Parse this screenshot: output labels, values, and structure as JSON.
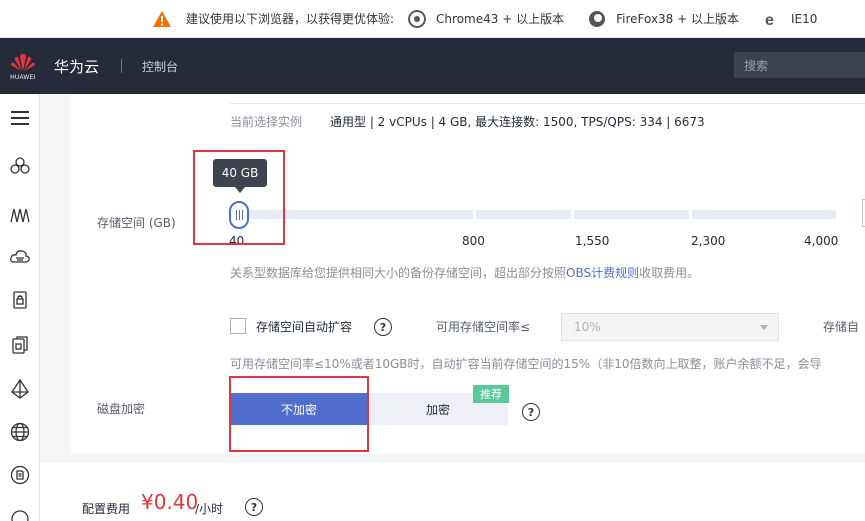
{
  "browser_warning": {
    "text": "建议使用以下浏览器，以获得更优体验:",
    "browsers": [
      "Chrome43 + 以上版本",
      "FireFox38 + 以上版本",
      "IE10"
    ]
  },
  "nav": {
    "logo_text": "HUAWEI",
    "brand": "华为云",
    "console": "控制台",
    "search_placeholder": "搜索"
  },
  "sidebar": {
    "icons": [
      "menu-icon",
      "cluster-icon",
      "chart-icon",
      "cloud-icon",
      "lock-icon",
      "copy-icon",
      "shape-icon",
      "globe-icon",
      "document-icon"
    ]
  },
  "instance": {
    "label": "当前选择实例",
    "value": "通用型 | 2 vCPUs | 4 GB, 最大连接数: 1500, TPS/QPS: 334 | 6673"
  },
  "storage": {
    "label": "存储空间 (GB)",
    "tooltip": "40 GB",
    "current_value": 40,
    "ticks": [
      "40",
      "800",
      "1,550",
      "2,300",
      "4,000"
    ],
    "desc_before": "关系型数据库给您提供相同大小的备份存储空间，超出部分按照",
    "desc_link": "OBS计费规则",
    "desc_after": "收取费用。"
  },
  "auto_expand": {
    "label": "存储空间自动扩容",
    "checked": false,
    "rate_label": "可用存储空间率≤",
    "rate_value": "10%",
    "cap_label": "存储自",
    "rule": "可用存储空间率≤10%或者10GB时，自动扩容当前存储空间的15%（非10倍数向上取整，账户余额不足，会导"
  },
  "encryption": {
    "label": "磁盘加密",
    "options": [
      "不加密",
      "加密"
    ],
    "selected": "不加密",
    "badge": "推荐"
  },
  "fee": {
    "label": "配置费用",
    "value": "¥0.40",
    "unit": "/小时"
  },
  "colors": {
    "primary": "#526ecc",
    "nav_bg": "#252b3a",
    "highlight": "#e3363c",
    "badge": "#5bc89a"
  }
}
